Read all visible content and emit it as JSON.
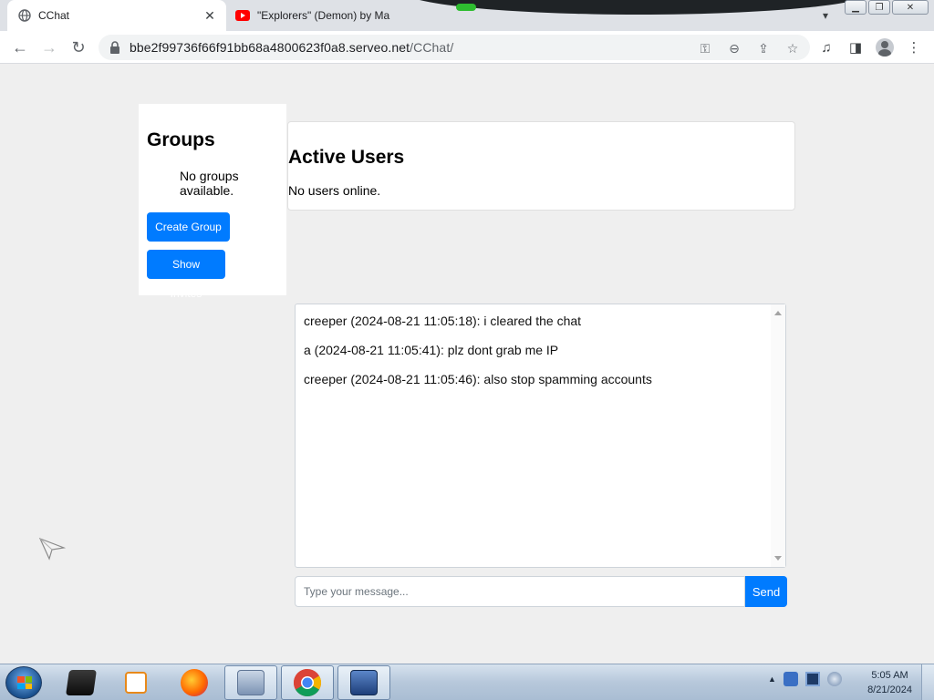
{
  "browser": {
    "tabs": [
      {
        "title": "CChat",
        "active": true
      },
      {
        "title": "\"Explorers\" (Demon) by Ma",
        "active": false
      }
    ],
    "url": {
      "host": "bbe2f99736f66f91bb68a4800623f0a8.serveo.net",
      "path": "/CChat/"
    }
  },
  "page": {
    "groups": {
      "heading": "Groups",
      "empty_text": "No groups available.",
      "create_label": "Create Group",
      "invites_label": "Show Invites"
    },
    "users": {
      "heading": "Active Users",
      "empty_text": "No users online."
    },
    "chat": {
      "messages": [
        "creeper (2024-08-21 11:05:18): i cleared the chat",
        "a (2024-08-21 11:05:41): plz dont grab me IP",
        "creeper (2024-08-21 11:05:46): also stop spamming accounts"
      ],
      "input_value": "",
      "input_placeholder": "Type your message...",
      "send_label": "Send"
    }
  },
  "taskbar": {
    "time": "5:05 AM",
    "date": "8/21/2024",
    "apps": [
      "terminal-app",
      "media-player-app",
      "firefox-app",
      "disk-utility-app",
      "chrome-app",
      "network-app"
    ]
  },
  "colors": {
    "accent": "#007bff",
    "page_bg": "#efefef",
    "panel_bg": "#ffffff"
  }
}
